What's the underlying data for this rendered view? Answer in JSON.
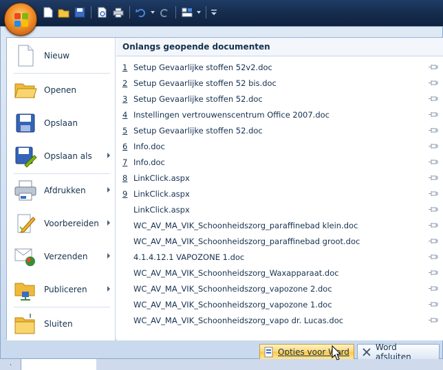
{
  "qat": {
    "icons": [
      "new-icon",
      "open-icon",
      "save-icon",
      "print-preview-icon",
      "print-icon",
      "undo-icon",
      "redo-icon",
      "customize-icon",
      "dropdown-icon"
    ]
  },
  "commands": [
    {
      "id": "new",
      "label": "Nieuw",
      "icon": "new-document-icon",
      "has_submenu": false
    },
    {
      "id": "open",
      "label": "Openen",
      "icon": "open-folder-icon",
      "has_submenu": false
    },
    {
      "id": "save",
      "label": "Opslaan",
      "icon": "save-disk-icon",
      "has_submenu": false
    },
    {
      "id": "save-as",
      "label": "Opslaan als",
      "icon": "save-as-icon",
      "has_submenu": true
    },
    {
      "id": "print",
      "label": "Afdrukken",
      "icon": "printer-icon",
      "has_submenu": true
    },
    {
      "id": "prepare",
      "label": "Voorbereiden",
      "icon": "prepare-icon",
      "has_submenu": true
    },
    {
      "id": "send",
      "label": "Verzenden",
      "icon": "send-icon",
      "has_submenu": true
    },
    {
      "id": "publish",
      "label": "Publiceren",
      "icon": "publish-icon",
      "has_submenu": true
    },
    {
      "id": "close",
      "label": "Sluiten",
      "icon": "close-folder-icon",
      "has_submenu": false
    }
  ],
  "recent": {
    "title": "Onlangs geopende documenten",
    "items": [
      {
        "num": "1",
        "name": "Setup Gevaarlijke stoffen 52v2.doc"
      },
      {
        "num": "2",
        "name": "Setup Gevaarlijke stoffen 52 bis.doc"
      },
      {
        "num": "3",
        "name": "Setup Gevaarlijke stoffen 52.doc"
      },
      {
        "num": "4",
        "name": "Instellingen vertrouwenscentrum Office 2007.doc"
      },
      {
        "num": "5",
        "name": "Setup Gevaarlijke stoffen 52.doc"
      },
      {
        "num": "6",
        "name": "Info.doc"
      },
      {
        "num": "7",
        "name": "Info.doc"
      },
      {
        "num": "8",
        "name": "LinkClick.aspx"
      },
      {
        "num": "9",
        "name": "LinkClick.aspx"
      },
      {
        "num": "",
        "name": "LinkClick.aspx"
      },
      {
        "num": "",
        "name": "WC_AV_MA_VIK_Schoonheidszorg_paraffinebad klein.doc"
      },
      {
        "num": "",
        "name": "WC_AV_MA_VIK_Schoonheidszorg_paraffinebad groot.doc"
      },
      {
        "num": "",
        "name": "4.1.4.12.1 VAPOZONE 1.doc"
      },
      {
        "num": "",
        "name": "WC_AV_MA_VIK_Schoonheidszorg_Waxapparaat.doc"
      },
      {
        "num": "",
        "name": "WC_AV_MA_VIK_Schoonheidszorg_vapozone 2.doc"
      },
      {
        "num": "",
        "name": "WC_AV_MA_VIK_Schoonheidszorg_vapozone 1.doc"
      },
      {
        "num": "",
        "name": "WC_AV_MA_VIK_Schoonheidszorg_vapo dr. Lucas.doc"
      }
    ]
  },
  "footer": {
    "options_label": "Opties voor Word",
    "exit_label": "Word afsluiten"
  },
  "below_mark": "·",
  "colors": {
    "accent": "#f2902a",
    "title_bar": "#1f3c66",
    "hot": "#ffd673"
  }
}
